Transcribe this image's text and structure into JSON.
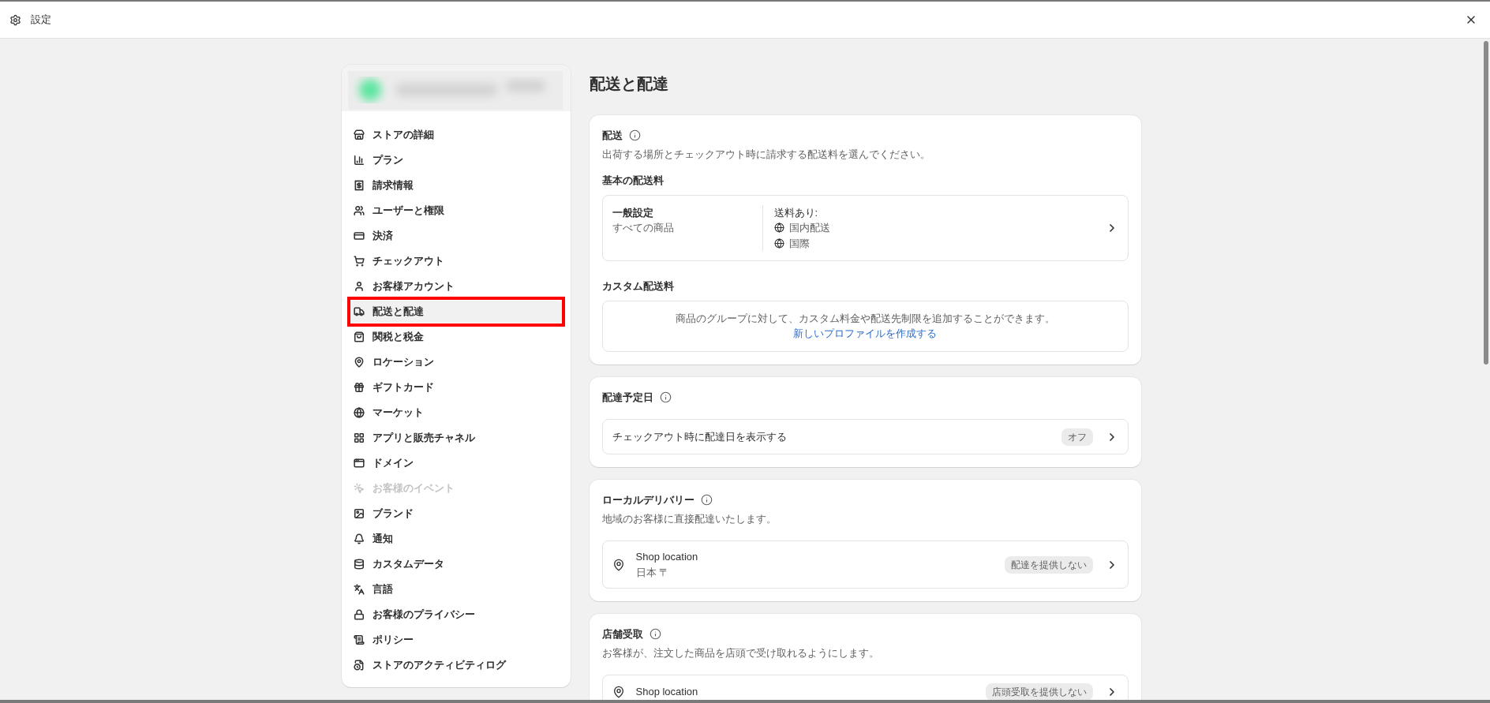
{
  "window": {
    "title": "設定"
  },
  "sidebar": {
    "items": [
      {
        "label": "ストアの詳細",
        "selected": false,
        "disabled": false,
        "annotated": false
      },
      {
        "label": "プラン",
        "selected": false,
        "disabled": false,
        "annotated": false
      },
      {
        "label": "請求情報",
        "selected": false,
        "disabled": false,
        "annotated": false
      },
      {
        "label": "ユーザーと権限",
        "selected": false,
        "disabled": false,
        "annotated": false
      },
      {
        "label": "決済",
        "selected": false,
        "disabled": false,
        "annotated": false
      },
      {
        "label": "チェックアウト",
        "selected": false,
        "disabled": false,
        "annotated": false
      },
      {
        "label": "お客様アカウント",
        "selected": false,
        "disabled": false,
        "annotated": false
      },
      {
        "label": "配送と配達",
        "selected": true,
        "disabled": false,
        "annotated": true
      },
      {
        "label": "関税と税金",
        "selected": false,
        "disabled": false,
        "annotated": false
      },
      {
        "label": "ロケーション",
        "selected": false,
        "disabled": false,
        "annotated": false
      },
      {
        "label": "ギフトカード",
        "selected": false,
        "disabled": false,
        "annotated": false
      },
      {
        "label": "マーケット",
        "selected": false,
        "disabled": false,
        "annotated": false
      },
      {
        "label": "アプリと販売チャネル",
        "selected": false,
        "disabled": false,
        "annotated": false
      },
      {
        "label": "ドメイン",
        "selected": false,
        "disabled": false,
        "annotated": false
      },
      {
        "label": "お客様のイベント",
        "selected": false,
        "disabled": true,
        "annotated": false
      },
      {
        "label": "ブランド",
        "selected": false,
        "disabled": false,
        "annotated": false
      },
      {
        "label": "通知",
        "selected": false,
        "disabled": false,
        "annotated": false
      },
      {
        "label": "カスタムデータ",
        "selected": false,
        "disabled": false,
        "annotated": false
      },
      {
        "label": "言語",
        "selected": false,
        "disabled": false,
        "annotated": false
      },
      {
        "label": "お客様のプライバシー",
        "selected": false,
        "disabled": false,
        "annotated": false
      },
      {
        "label": "ポリシー",
        "selected": false,
        "disabled": false,
        "annotated": false
      },
      {
        "label": "ストアのアクティビティログ",
        "selected": false,
        "disabled": false,
        "annotated": false
      }
    ]
  },
  "page_title": "配送と配達",
  "sections": [
    {
      "kind": "shipping",
      "title": "配送",
      "description": "出荷する場所とチェックアウト時に請求する配送料を選んでください。",
      "general_heading": "基本の配送料",
      "profile": {
        "name": "一般設定",
        "subtitle": "すべての商品",
        "rates_label": "送料あり:",
        "zones": [
          "国内配送",
          "国際"
        ]
      },
      "custom_heading": "カスタム配送料",
      "custom_text": "商品のグループに対して、カスタム料金や配送先制限を追加することができます。",
      "custom_link": "新しいプロファイルを作成する"
    },
    {
      "kind": "setting",
      "title": "配達予定日",
      "row_label": "チェックアウト時に配達日を表示する",
      "status": "オフ"
    },
    {
      "kind": "location",
      "title": "ローカルデリバリー",
      "description": "地域のお客様に直接配達いたします。",
      "location": {
        "name": "Shop location",
        "address": "日本 〒",
        "status": "配達を提供しない"
      }
    },
    {
      "kind": "location",
      "title": "店舗受取",
      "description": "お客様が、注文した商品を店頭で受け取れるようにします。",
      "location": {
        "name": "Shop location",
        "status": "店頭受取を提供しない"
      }
    }
  ]
}
